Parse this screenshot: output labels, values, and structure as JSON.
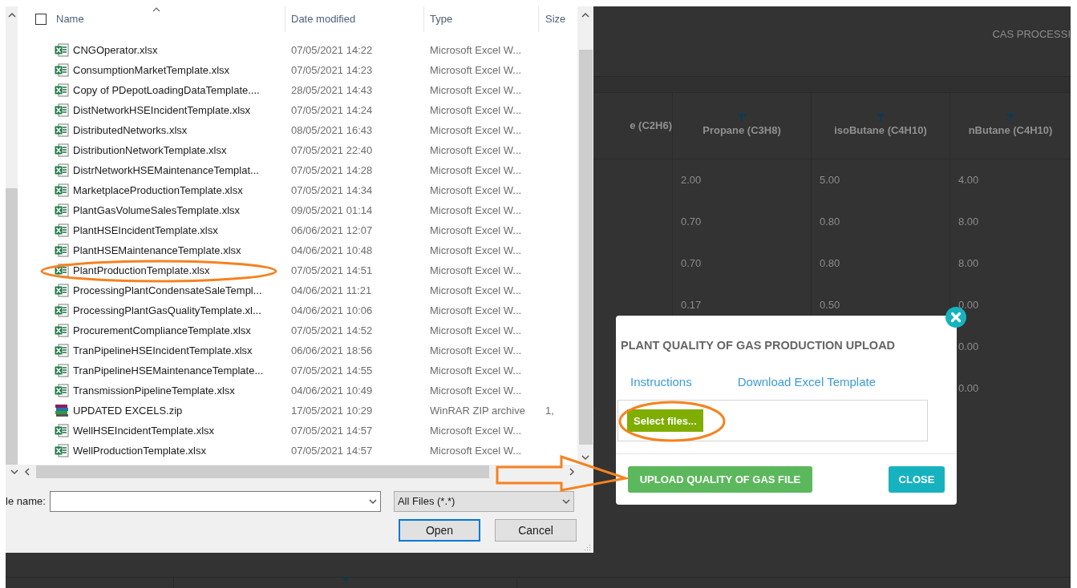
{
  "background_page": {
    "title": "CAS PROCESSI",
    "columns": [
      {
        "label": "e (C2H6)",
        "filter": false
      },
      {
        "label": "Propane (C3H8)",
        "filter": true
      },
      {
        "label": "isoButane (C4H10)",
        "filter": true
      },
      {
        "label": "nButane (C4H10)",
        "filter": true
      }
    ],
    "rows": [
      {
        "propane": "2.00",
        "isobutane": "5.00",
        "nbutane": "4.00"
      },
      {
        "propane": "0.70",
        "isobutane": "0.80",
        "nbutane": "8.00"
      },
      {
        "propane": "0.70",
        "isobutane": "0.80",
        "nbutane": "8.00"
      },
      {
        "propane": "0.17",
        "isobutane": "0.50",
        "nbutane": "0.00"
      },
      {
        "nbutane": "0.00"
      },
      {
        "nbutane": "0.00"
      }
    ]
  },
  "file_dialog": {
    "columns": [
      "Name",
      "Date modified",
      "Type",
      "Size"
    ],
    "select_all_checked": false,
    "files": [
      {
        "name": "CNGOperator.xlsx",
        "date": "07/05/2021 14:22",
        "type": "Microsoft Excel W...",
        "kind": "excel",
        "circled": false
      },
      {
        "name": "ConsumptionMarketTemplate.xlsx",
        "date": "07/05/2021 14:23",
        "type": "Microsoft Excel W...",
        "kind": "excel",
        "circled": false
      },
      {
        "name": "Copy of PDepotLoadingDataTemplate....",
        "date": "28/05/2021 14:43",
        "type": "Microsoft Excel W...",
        "kind": "excel",
        "circled": false
      },
      {
        "name": "DistNetworkHSEIncidentTemplate.xlsx",
        "date": "07/05/2021 14:24",
        "type": "Microsoft Excel W...",
        "kind": "excel",
        "circled": false
      },
      {
        "name": "DistributedNetworks.xlsx",
        "date": "08/05/2021 16:43",
        "type": "Microsoft Excel W...",
        "kind": "excel",
        "circled": false
      },
      {
        "name": "DistributionNetworkTemplate.xlsx",
        "date": "07/05/2021 22:40",
        "type": "Microsoft Excel W...",
        "kind": "excel",
        "circled": false
      },
      {
        "name": "DistrNetworkHSEMaintenanceTemplat...",
        "date": "07/05/2021 14:28",
        "type": "Microsoft Excel W...",
        "kind": "excel",
        "circled": false
      },
      {
        "name": "MarketplaceProductionTemplate.xlsx",
        "date": "07/05/2021 14:34",
        "type": "Microsoft Excel W...",
        "kind": "excel",
        "circled": false
      },
      {
        "name": "PlantGasVolumeSalesTemplate.xlsx",
        "date": "09/05/2021 01:14",
        "type": "Microsoft Excel W...",
        "kind": "excel",
        "circled": false
      },
      {
        "name": "PlantHSEIncidentTemplate.xlsx",
        "date": "06/06/2021 12:07",
        "type": "Microsoft Excel W...",
        "kind": "excel",
        "circled": false
      },
      {
        "name": "PlantHSEMaintenanceTemplate.xlsx",
        "date": "04/06/2021 10:48",
        "type": "Microsoft Excel W...",
        "kind": "excel",
        "circled": false
      },
      {
        "name": "PlantProductionTemplate.xlsx",
        "date": "07/05/2021 14:51",
        "type": "Microsoft Excel W...",
        "kind": "excel",
        "circled": true
      },
      {
        "name": "ProcessingPlantCondensateSaleTempl...",
        "date": "04/06/2021 11:21",
        "type": "Microsoft Excel W...",
        "kind": "excel",
        "circled": false
      },
      {
        "name": "ProcessingPlantGasQualityTemplate.xl...",
        "date": "04/06/2021 10:06",
        "type": "Microsoft Excel W...",
        "kind": "excel",
        "circled": false
      },
      {
        "name": "ProcurementComplianceTemplate.xlsx",
        "date": "07/05/2021 14:52",
        "type": "Microsoft Excel W...",
        "kind": "excel",
        "circled": false
      },
      {
        "name": "TranPipelineHSEIncidentTemplate.xlsx",
        "date": "06/06/2021 18:56",
        "type": "Microsoft Excel W...",
        "kind": "excel",
        "circled": false
      },
      {
        "name": "TranPipelineHSEMaintenanceTemplate...",
        "date": "07/05/2021 14:55",
        "type": "Microsoft Excel W...",
        "kind": "excel",
        "circled": false
      },
      {
        "name": "TransmissionPipelineTemplate.xlsx",
        "date": "04/06/2021 10:49",
        "type": "Microsoft Excel W...",
        "kind": "excel",
        "circled": false
      },
      {
        "name": "UPDATED EXCELS.zip",
        "date": "17/05/2021 10:29",
        "type": "WinRAR ZIP archive",
        "size": "1,",
        "kind": "zip",
        "circled": false
      },
      {
        "name": "WellHSEIncidentTemplate.xlsx",
        "date": "07/05/2021 14:57",
        "type": "Microsoft Excel W...",
        "kind": "excel",
        "circled": false
      },
      {
        "name": "WellProductionTemplate.xlsx",
        "date": "07/05/2021 14:57",
        "type": "Microsoft Excel W...",
        "kind": "excel",
        "circled": false
      }
    ],
    "file_name_label": "le name:",
    "file_type": "All Files (*.*)",
    "buttons": [
      {
        "label": "Open",
        "default": true
      },
      {
        "label": "Cancel",
        "default": false
      }
    ]
  },
  "upload_modal": {
    "title": "PLANT QUALITY OF GAS PRODUCTION UPLOAD",
    "links": [
      "Instructions",
      "Download Excel Template"
    ],
    "select_button": {
      "label": "Select files...",
      "circled": true
    },
    "actions": [
      {
        "label": "UPLOAD QUALITY OF GAS FILE",
        "kind": "primary"
      },
      {
        "label": "CLOSE",
        "kind": "secondary"
      }
    ]
  }
}
